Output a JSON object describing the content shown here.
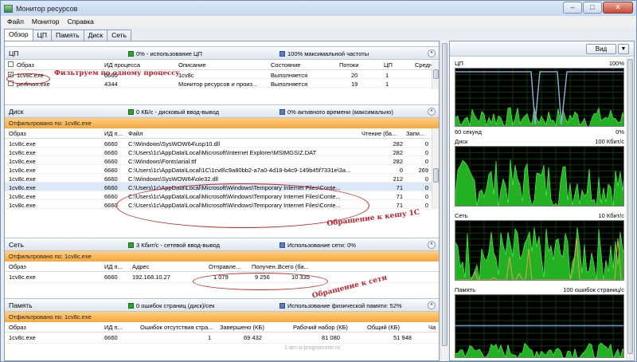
{
  "window": {
    "title": "Монитор ресурсов",
    "min": "–",
    "max": "□",
    "close": "✕"
  },
  "menu": [
    "Файл",
    "Монитор",
    "Справка"
  ],
  "tabs": [
    "Обзор",
    "ЦП",
    "Память",
    "Диск",
    "Сеть"
  ],
  "cpu": {
    "name": "ЦП",
    "stat1": "0% - использование ЦП",
    "stat2": "100% максимальной частоты",
    "columns": [
      "Образ",
      "ИД процесса",
      "Описание",
      "Состояние",
      "Потоки",
      "ЦП",
      "Средн"
    ],
    "rows": [
      {
        "image": "1cv8c.exe",
        "pid": "6660",
        "desc": "1cv8c",
        "state": "Выполняется",
        "threads": "20",
        "cpu": "1",
        "checked": true
      },
      {
        "image": "perfmon.exe",
        "pid": "4344",
        "desc": "Монитор ресурсов и произ...",
        "state": "Выполняется",
        "threads": "19",
        "cpu": "1",
        "checked": false
      }
    ]
  },
  "disk": {
    "name": "Диск",
    "stat1": "0 КБ/с - дисковый ввод-вывод",
    "stat2": "0% активного времени (максимально)",
    "filter": "Отфильтровано по: 1cv8c.exe",
    "columns": [
      "Образ",
      "ИД п...",
      "Файл",
      "Чтение (ба...",
      "Запи..."
    ],
    "rows": [
      {
        "image": "1cv8c.exe",
        "pid": "6660",
        "file": "C:\\Windows\\SysWOW64\\usp10.dll",
        "read": "282",
        "write": "0"
      },
      {
        "image": "1cv8c.exe",
        "pid": "6660",
        "file": "C:\\Users\\1c\\AppData\\Local\\Microsoft\\Internet Explorer\\MSIMGSIZ.DAT",
        "read": "282",
        "write": "0"
      },
      {
        "image": "1cv8c.exe",
        "pid": "6660",
        "file": "C:\\Windows\\Fonts\\arial.ttf",
        "read": "282",
        "write": "0"
      },
      {
        "image": "1cv8c.exe",
        "pid": "6660",
        "file": "C:\\Users\\1c\\AppData\\Local\\1C\\1cv8\\c9a80bb2-a7a0-4d18-b4c9-149b45f7331e\\3a...",
        "read": "0",
        "write": "269"
      },
      {
        "image": "1cv8c.exe",
        "pid": "6660",
        "file": "C:\\Windows\\SysWOW64\\ole32.dll",
        "read": "212",
        "write": "0"
      },
      {
        "image": "1cv8c.exe",
        "pid": "6660",
        "file": "C:\\Users\\1c\\AppData\\Local\\Microsoft\\Windows\\Temporary Internet Files\\Conte...",
        "read": "71",
        "write": "0"
      },
      {
        "image": "1cv8c.exe",
        "pid": "6660",
        "file": "C:\\Users\\1c\\AppData\\Local\\Microsoft\\Windows\\Temporary Internet Files\\Conte...",
        "read": "71",
        "write": "0"
      },
      {
        "image": "1cv8c.exe",
        "pid": "6660",
        "file": "C:\\Users\\1c\\AppData\\Local\\Microsoft\\Windows\\Temporary Internet Files\\Conte...",
        "read": "71",
        "write": "0"
      }
    ]
  },
  "net": {
    "name": "Сеть",
    "stat1": "3 Кбит/с - сетевой ввод-вывод",
    "stat2": "Использование сети: 0%",
    "filter": "Отфильтровано по: 1cv8c.exe",
    "columns": [
      "Образ",
      "ИД п...",
      "Адрес",
      "Отправле...",
      "Получен...",
      "Всего (ба..."
    ],
    "rows": [
      {
        "image": "1cv8c.exe",
        "pid": "6660",
        "addr": "192.168.10.27",
        "sent": "1 079",
        "recv": "9 256",
        "total": "10 335"
      }
    ]
  },
  "mem": {
    "name": "Память",
    "stat1": "0 ошибок страниц (диск)/сек",
    "stat2": "Использование физической памяти: 52%",
    "filter": "Отфильтровано по: 1cv8c.exe",
    "columns": [
      "Образ",
      "ИД п...",
      "Ошибок отсутствия стра...",
      "Завершено (КБ)",
      "Рабочий набор (КБ)",
      "Общий (КБ)",
      "Ча"
    ],
    "rows": [
      {
        "image": "1cv8c.exe",
        "pid": "6660",
        "faults": "1",
        "commit": "69 432",
        "ws": "81 080",
        "shared": "51 948"
      }
    ]
  },
  "annotations": {
    "filter_note": "Фильтруем по одному процессу",
    "cache_note": "Обращение к кешу 1С",
    "net_note": "Обращение к сети"
  },
  "graphs": {
    "view_button": "Вид",
    "cpu_label": "ЦП",
    "cpu_max": "100%",
    "cpu_time": "60 секунд",
    "cpu_min": "0%",
    "disk_label": "Диск",
    "disk_max": "100 Кбит/с",
    "net_label": "Сеть",
    "net_max": "10 Кбит/с",
    "mem_label": "Память",
    "mem_max": "100 ошибок страниц/с"
  },
  "watermark": "1-am-a-programmer.ru"
}
